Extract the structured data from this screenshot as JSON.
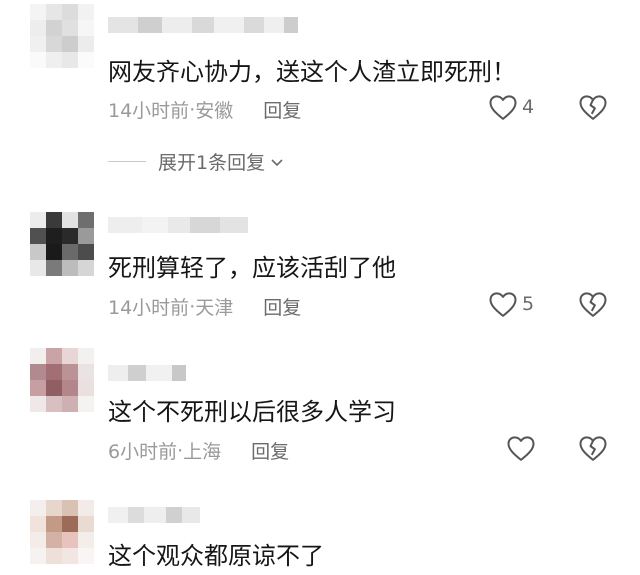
{
  "comments": [
    {
      "text": "网友齐心协力，送这个人渣立即死刑！",
      "time": "14小时前",
      "location": "安徽",
      "reply_label": "回复",
      "likes": "4",
      "expand_label": "展开1条回复"
    },
    {
      "text": "死刑算轻了，应该活刮了他",
      "time": "14小时前",
      "location": "天津",
      "reply_label": "回复",
      "likes": "5"
    },
    {
      "text": "这个不死刑以后很多人学习",
      "time": "6小时前",
      "location": "上海",
      "reply_label": "回复",
      "likes": ""
    },
    {
      "text": "这个观众都原谅不了"
    }
  ],
  "separator": " · ",
  "icons": {
    "like": "heart-outline-icon",
    "dislike": "broken-heart-icon",
    "expand": "chevron-down-icon"
  }
}
